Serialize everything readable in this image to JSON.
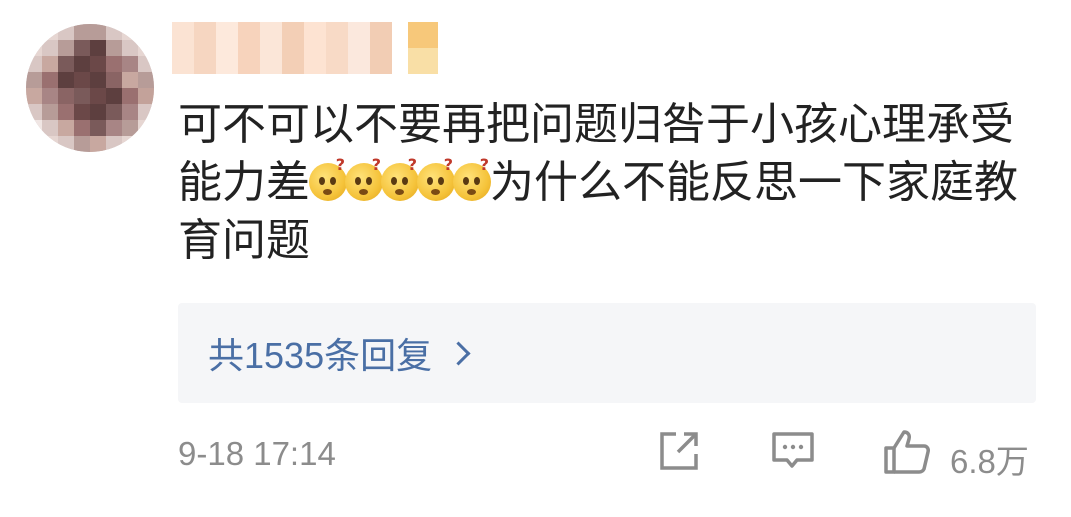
{
  "comment": {
    "text_before_emoji": "可不可以不要再把问题归咎于小孩心理承受能力差",
    "emoji_name": "thinking-face-emoji",
    "emoji_count": 5,
    "text_after_emoji": "为什么不能反思一下家庭教育问题"
  },
  "replies": {
    "label": "共1535条回复"
  },
  "footer": {
    "timestamp": "9-18 17:14",
    "like_count": "6.8万",
    "icons": [
      "share-icon",
      "comment-icon",
      "like-icon"
    ]
  },
  "colors": {
    "text": "#222222",
    "link": "#4a6fa5",
    "meta": "#8c8c8c",
    "reply_bg": "#f5f6f8"
  }
}
